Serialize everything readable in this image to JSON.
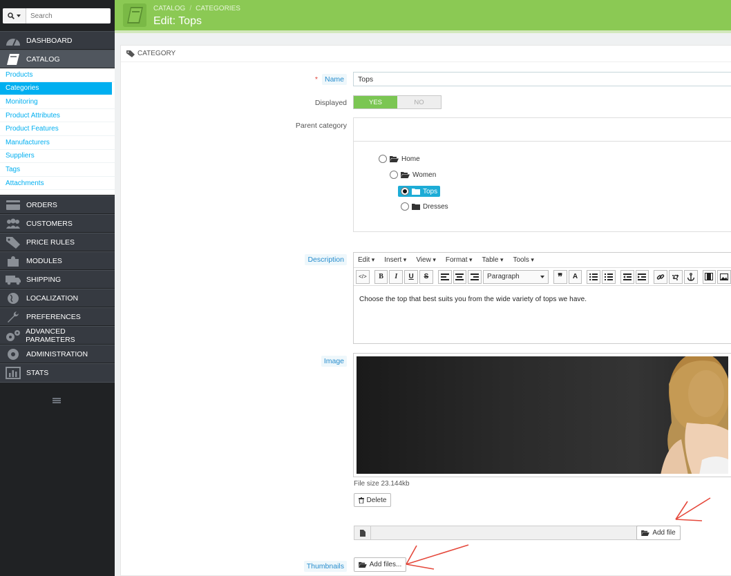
{
  "search": {
    "placeholder": "Search"
  },
  "nav": {
    "top": [
      {
        "label": "Dashboard",
        "icon": "dashboard-icon"
      },
      {
        "label": "Catalog",
        "icon": "book-icon"
      }
    ],
    "catalog_submenu": [
      "Products",
      "Categories",
      "Monitoring",
      "Product Attributes",
      "Product Features",
      "Manufacturers",
      "Suppliers",
      "Tags",
      "Attachments"
    ],
    "bottom": [
      {
        "label": "Orders",
        "icon": "credit-card-icon"
      },
      {
        "label": "Customers",
        "icon": "users-icon"
      },
      {
        "label": "Price Rules",
        "icon": "tags-icon"
      },
      {
        "label": "Modules",
        "icon": "puzzle-icon"
      },
      {
        "label": "Shipping",
        "icon": "truck-icon"
      },
      {
        "label": "Localization",
        "icon": "globe-icon"
      },
      {
        "label": "Preferences",
        "icon": "wrench-icon"
      },
      {
        "label": "Advanced Parameters",
        "icon": "cogs-icon"
      },
      {
        "label": "Administration",
        "icon": "gear-icon"
      },
      {
        "label": "Stats",
        "icon": "bar-chart-icon"
      }
    ]
  },
  "header": {
    "breadcrumb": [
      "Catalog",
      "Categories"
    ],
    "title": "Edit: Tops"
  },
  "panel": {
    "heading": "Category"
  },
  "form": {
    "name_label": "Name",
    "name_value": "Tops",
    "displayed_label": "Displayed",
    "yes": "YES",
    "no": "NO",
    "parent_label": "Parent category",
    "tree": [
      "Home",
      "Women",
      "Tops",
      "Dresses"
    ],
    "description_label": "Description",
    "editor_menu": [
      "Edit",
      "Insert",
      "View",
      "Format",
      "Table",
      "Tools"
    ],
    "format_value": "Paragraph",
    "description_text": "Choose the top that best suits you from the wide variety of tops we have.",
    "image_label": "Image",
    "file_size": "File size 23.144kb",
    "delete_label": "Delete",
    "add_file_label": "Add file",
    "thumbnails_label": "Thumbnails",
    "add_files_label": "Add files..."
  },
  "colors": {
    "header": "#8bc954",
    "accent": "#00aff0",
    "sidebar": "#363a41",
    "annotation": "#e5483b"
  }
}
